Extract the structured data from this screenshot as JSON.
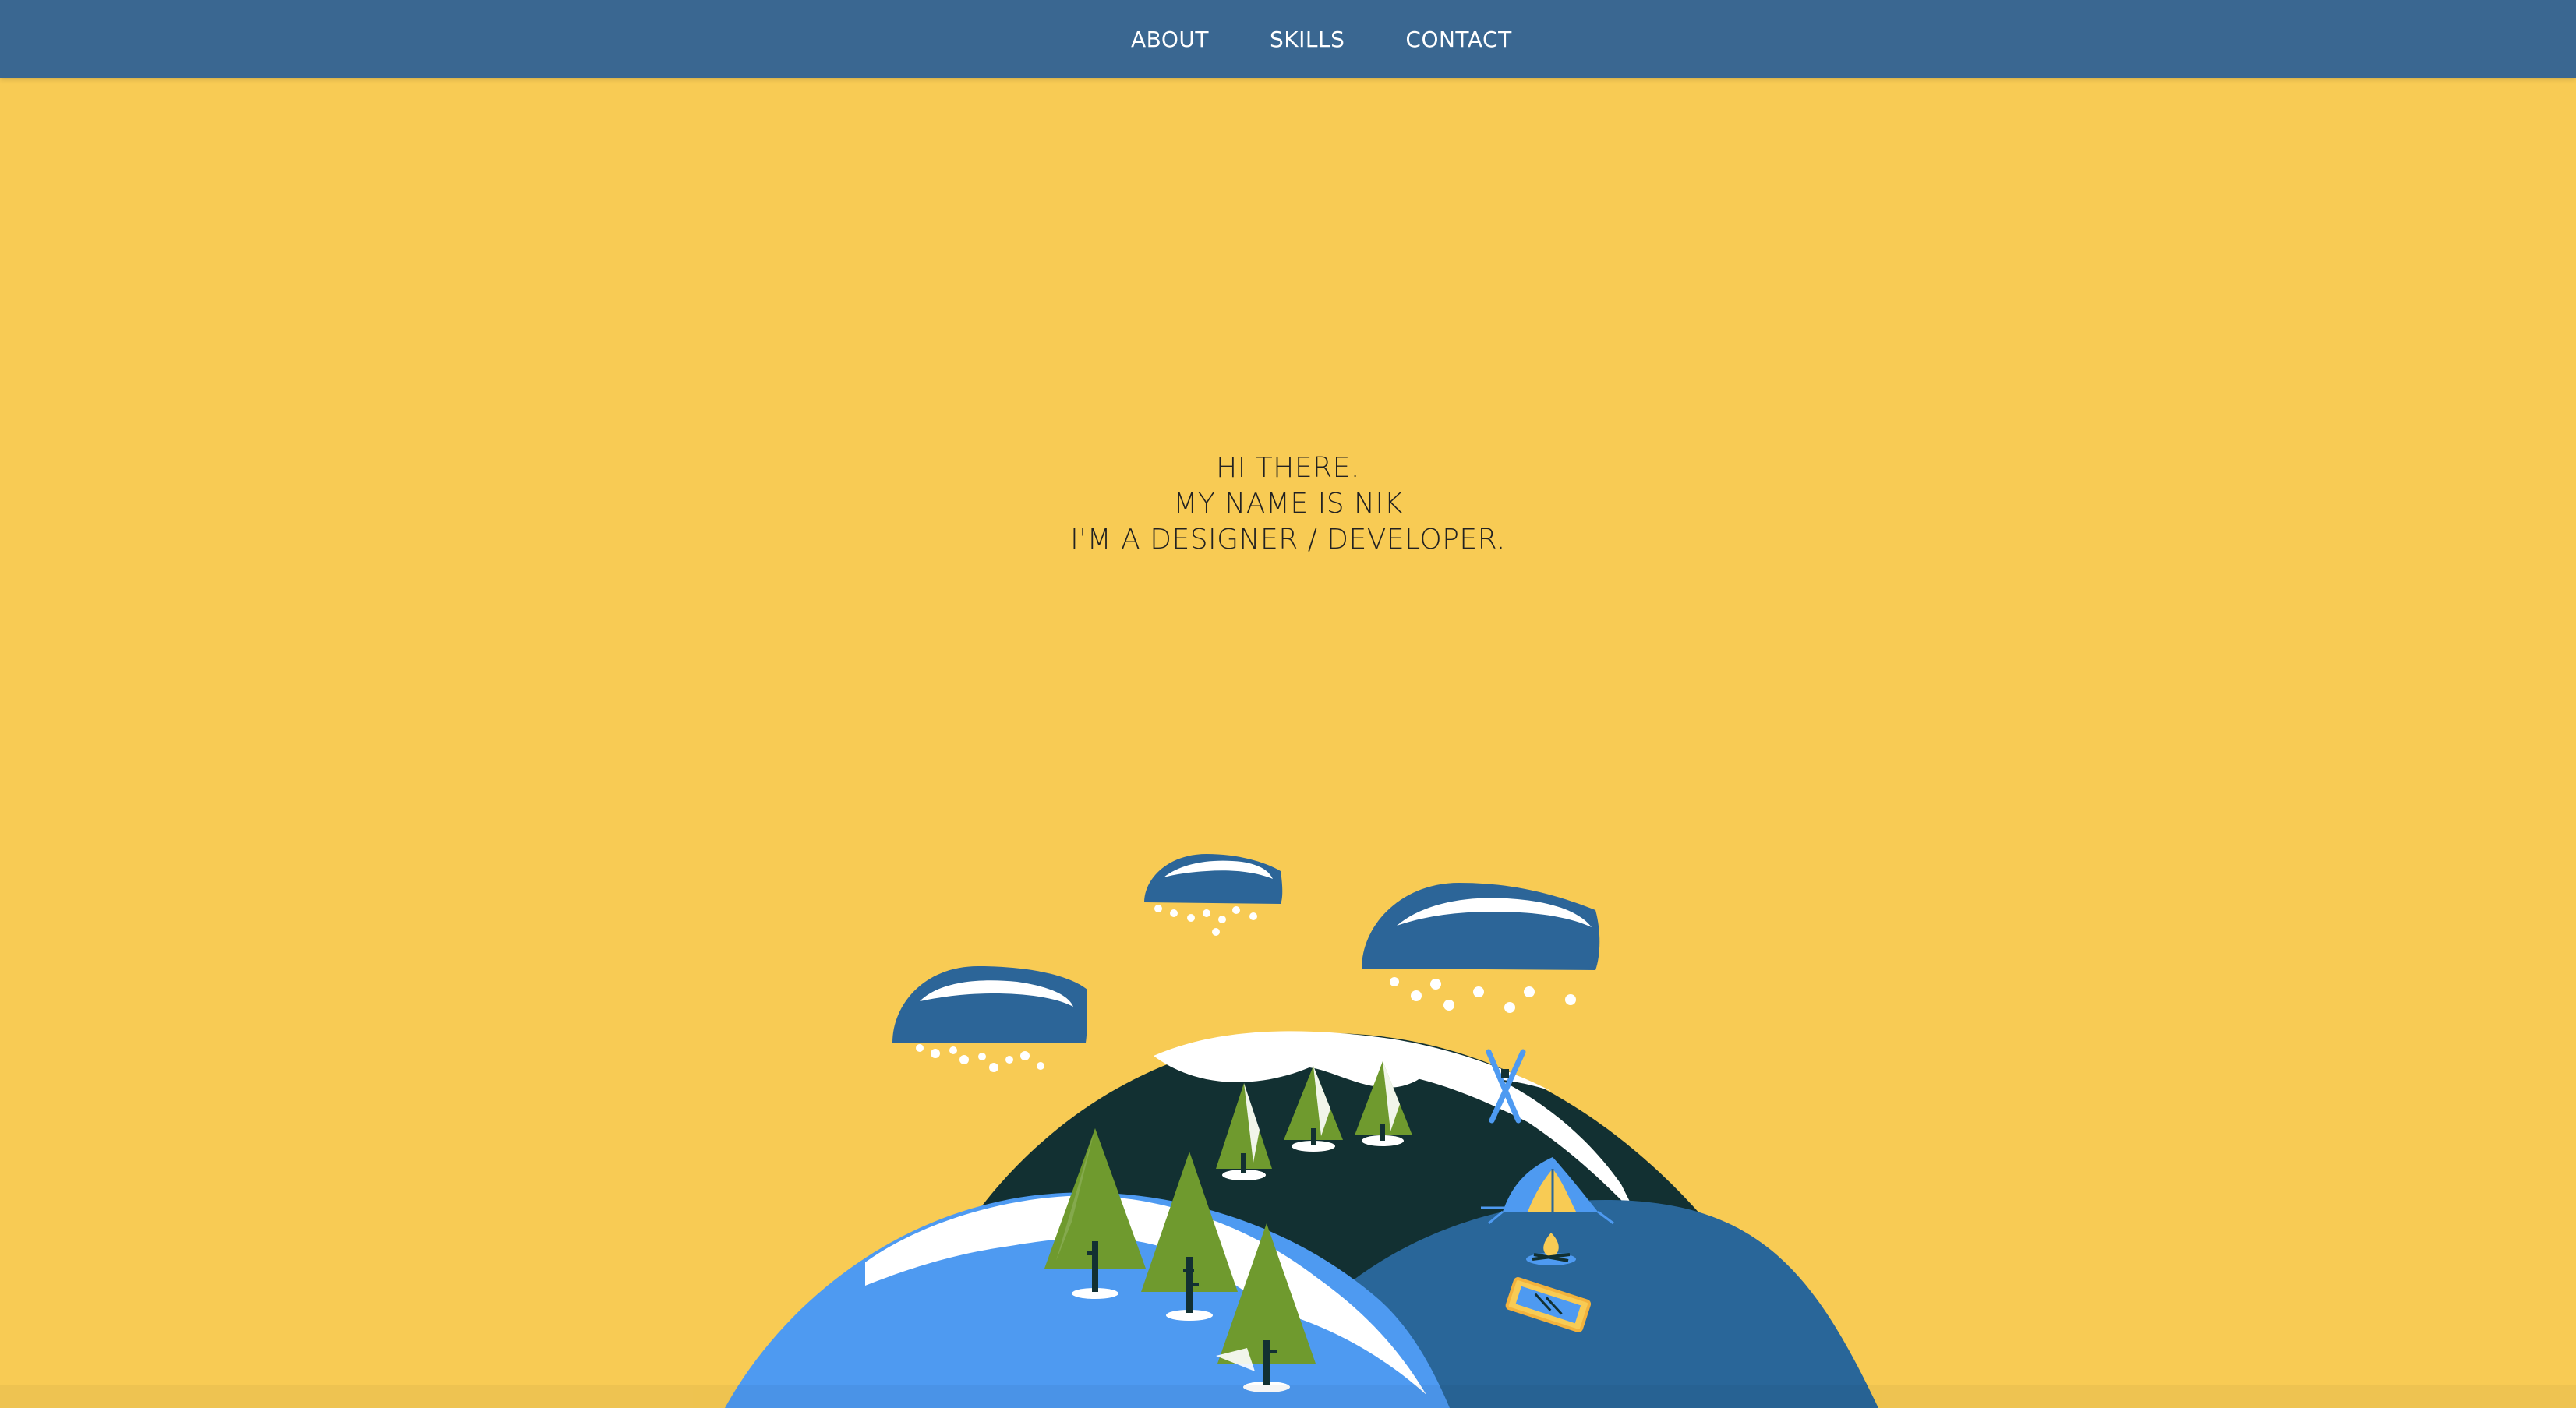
{
  "nav": {
    "items": [
      {
        "label": "ABOUT"
      },
      {
        "label": "SKILLS"
      },
      {
        "label": "CONTACT"
      }
    ]
  },
  "hero": {
    "lines": [
      "HI THERE.",
      "MY NAME IS NIK",
      "I'M A DESIGNER / DEVELOPER."
    ]
  },
  "colors": {
    "background": "#F8CB54",
    "header": "#3A6791",
    "cloud": "#2C6598",
    "hill_dark": "#123032",
    "hill_light_blue": "#4E9AF1",
    "hill_mid_blue": "#296699",
    "tree_green": "#6F9A2E",
    "snow": "#FFFFFF"
  },
  "illustration": {
    "icons": [
      "cloud-icon",
      "tree-icon",
      "tent-icon",
      "campfire-icon",
      "skis-icon",
      "sled-icon",
      "snowflake-icon"
    ]
  }
}
